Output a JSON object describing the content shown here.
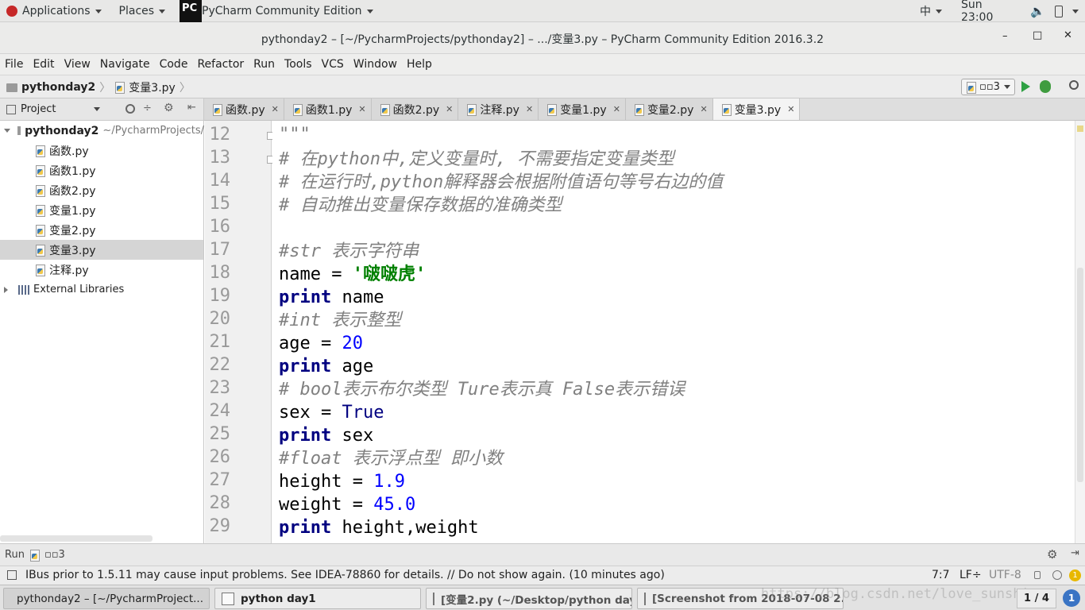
{
  "topbar": {
    "applications": "Applications",
    "places": "Places",
    "app_name": "PyCharm Community Edition",
    "input_method": "中",
    "clock": "Sun 23:00"
  },
  "window": {
    "title": "pythonday2 – [~/PycharmProjects/pythonday2] – .../变量3.py – PyCharm Community Edition 2016.3.2",
    "minimize": "–",
    "maximize": "□",
    "close": "✕"
  },
  "menu": [
    "File",
    "Edit",
    "View",
    "Navigate",
    "Code",
    "Refactor",
    "Run",
    "Tools",
    "VCS",
    "Window",
    "Help"
  ],
  "navbar": {
    "project": "pythonday2",
    "file": "变量3.py",
    "run_config": "▫▫3"
  },
  "project_panel": {
    "title": "Project",
    "root": "pythonday2",
    "root_path": "~/PycharmProjects/",
    "files": [
      "函数.py",
      "函数1.py",
      "函数2.py",
      "变量1.py",
      "变量2.py",
      "变量3.py",
      "注释.py"
    ],
    "external": "External Libraries"
  },
  "tabs": [
    "函数.py",
    "函数1.py",
    "函数2.py",
    "注释.py",
    "变量1.py",
    "变量2.py",
    "变量3.py"
  ],
  "editor": {
    "line_numbers": [
      "12",
      "13",
      "14",
      "15",
      "16",
      "17",
      "18",
      "19",
      "20",
      "21",
      "22",
      "23",
      "24",
      "25",
      "26",
      "27",
      "28",
      "29"
    ],
    "lines": {
      "l12": "\"\"\"",
      "l13": "# 在python中,定义变量时, 不需要指定变量类型",
      "l14": "# 在运行时,python解释器会根据附值语句等号右边的值",
      "l15": "# 自动推出变量保存数据的准确类型",
      "l17": "#str 表示字符串",
      "l18a": "name = ",
      "l18b": "'啵啵虎'",
      "l19a": "print",
      "l19b": " name",
      "l20": "#int 表示整型",
      "l21a": "age = ",
      "l21b": "20",
      "l22a": "print",
      "l22b": " age",
      "l23": "# bool表示布尔类型 Ture表示真 False表示错误",
      "l24a": "sex = ",
      "l24b": "True",
      "l25a": "print",
      "l25b": " sex",
      "l26": "#float 表示浮点型 即小数",
      "l27a": "height = ",
      "l27b": "1.9",
      "l28a": "weight = ",
      "l28b": "45.0",
      "l29a": "print",
      "l29b": " height,weight"
    }
  },
  "runbar": {
    "label": "Run",
    "config": "▫▫3"
  },
  "status": {
    "message": "IBus prior to 1.5.11 may cause input problems. See IDEA-78860 for details. // Do not show again. (10 minutes ago)",
    "position": "7:7",
    "line_sep": "LF÷",
    "encoding": "UTF-8",
    "notifications": "1"
  },
  "taskbar": {
    "items": [
      "pythonday2 – [~/PycharmProject...",
      "python day1",
      "[变量2.py (~/Desktop/python day...",
      "[Screenshot from 2018-07-08 2..."
    ],
    "workspace": "1 / 4",
    "watermark": "https://blog.csdn.net/love_sunshine"
  }
}
